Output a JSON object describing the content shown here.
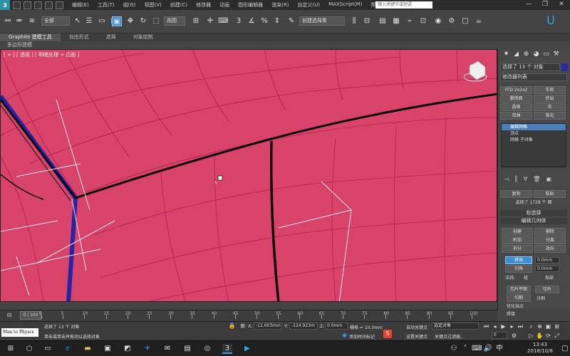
{
  "title_bar": {
    "logo": "3",
    "menus": [
      "编辑(E)",
      "工具(T)",
      "组(G)",
      "视图(V)",
      "创建(C)",
      "修改器",
      "动画",
      "图形编辑器",
      "渲染(R)",
      "自定义(U)",
      "MAXScript(M)",
      "帮助(H)"
    ],
    "help_search_placeholder": "键入关键字或短语",
    "window_controls": [
      "—",
      "❐",
      "✕"
    ]
  },
  "toolbar": {
    "selection_filter": "全部",
    "reference_coord": "视图",
    "named_selection": "创建选择集",
    "active_tool": "select-region"
  },
  "ribbon": {
    "tabs": [
      "Graphite 建模工具",
      "自由形式",
      "选择",
      "对象绘制"
    ],
    "active_tab": 0,
    "subtitle": "多边形建模"
  },
  "viewport": {
    "label": "[ + ] [ 透视 ] [ 明暗处理 + 边面 ]",
    "background_color": "#d8436a",
    "grid_color": "#b02050",
    "border_color": "#0a0a0a",
    "selected_edge_color": "#2424a8"
  },
  "command_panel": {
    "tabs": [
      "✷",
      "◢",
      "⊕",
      "◕",
      "▭",
      "⚒"
    ],
    "object_name": "选择了 13 个 对象",
    "modifier_list": "修改器列表",
    "buttons_grid": [
      [
        "FFD 2x2x2",
        "车削"
      ],
      [
        "删除面",
        "挤出"
      ],
      [
        "晶格",
        "壳"
      ],
      [
        "弯曲",
        "锥化"
      ]
    ],
    "stack": [
      {
        "label": "编辑网格",
        "selected": true
      },
      {
        "label": "顶点",
        "selected": false
      },
      {
        "label": "网格 子对象",
        "selected": false
      }
    ],
    "copy_btn": "复制",
    "paste_btn": "粘贴",
    "selected_info": "选择了 1728 个 面",
    "soft_selection": "软选择",
    "edit_geometry": "编辑几何体",
    "geo_buttons": [
      [
        "创建",
        "删除"
      ],
      [
        "附加",
        "分离"
      ],
      [
        "拆分",
        "改向"
      ]
    ],
    "extrude_label": "挤出",
    "extrude_value": "0.0mm",
    "chamfer_label": "切角",
    "chamfer_value": "0.0mm",
    "normal_label": "法线:",
    "normal_group": "组",
    "normal_local": "局部",
    "slice_plane": "切片平面",
    "slice": "切片",
    "cut": "切割",
    "split": "分割",
    "refine_ends": "优化端点",
    "weld": "焊接"
  },
  "timeline": {
    "position": "0 / 100",
    "ticks": [
      0,
      5,
      10,
      15,
      20,
      25,
      30,
      35,
      40,
      45,
      50,
      55,
      60,
      65,
      70,
      75,
      80,
      85,
      90,
      95,
      100
    ]
  },
  "status_bar": {
    "max_to_physics": "Max to Physcs",
    "selection_info": "选择了 13 个 对象",
    "prompt": "单击或单击并拖动以选择对象",
    "x_label": "X:",
    "x_value": "-12.003mm",
    "y_label": "Y:",
    "y_value": "-124.923m",
    "z_label": "Z:",
    "z_value": "0.0mm",
    "grid": "栅格 = 10.0mm",
    "add_time_tag": "添加时间标记",
    "auto_key": "自动关键点",
    "selected_object": "选定对象",
    "set_key": "设置关键点",
    "key_filter": "关键点过滤器...",
    "frame": "0"
  },
  "taskbar": {
    "start_icon": "windows-logo",
    "time": "13:43",
    "date": "2018/10/8"
  }
}
